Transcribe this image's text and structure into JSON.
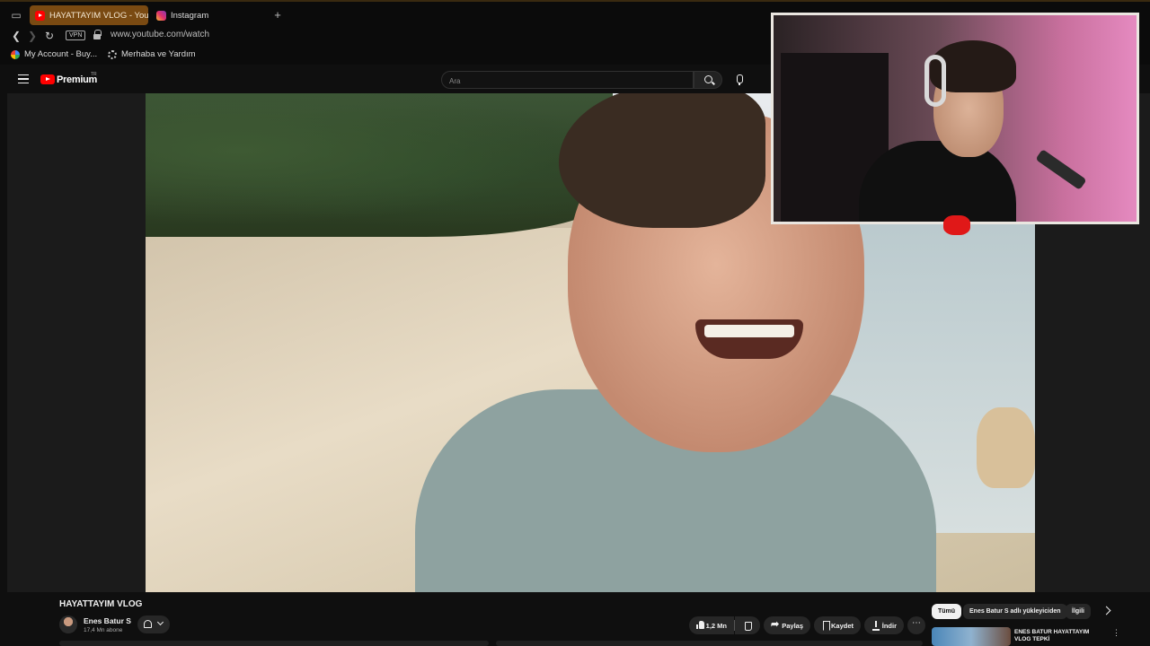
{
  "browser": {
    "tabs": [
      {
        "label": "HAYATTAYIM VLOG - YouT",
        "active": true
      },
      {
        "label": "Instagram",
        "active": false
      }
    ],
    "vpn_label": "VPN",
    "url": "www.youtube.com/watch",
    "bookmarks": [
      {
        "label": "My Account - Buy..."
      },
      {
        "label": "Merhaba ve Yardım"
      }
    ]
  },
  "youtube": {
    "logo_label": "Premium",
    "country_code": "TR",
    "search_placeholder": "Ara"
  },
  "video": {
    "title": "HAYATTAYIM VLOG",
    "channel_name": "Enes Batur S",
    "subscribers": "17,4 Mn abone",
    "like_count": "1,2 Mn",
    "actions": {
      "share": "Paylaş",
      "save": "Kaydet",
      "download": "İndir"
    }
  },
  "recommendations": {
    "chips": [
      {
        "label": "Tümü",
        "selected": true
      },
      {
        "label": "Enes Batur S adlı yükleyiciden",
        "selected": false
      },
      {
        "label": "İlgili",
        "selected": false
      }
    ],
    "first_item_title": "ENES BATUR HAYATTAYIM VLOG TEPKİ"
  },
  "colors": {
    "accent": "#ff0000",
    "active_tab": "#7a4a12",
    "background": "#0f0f0f"
  }
}
